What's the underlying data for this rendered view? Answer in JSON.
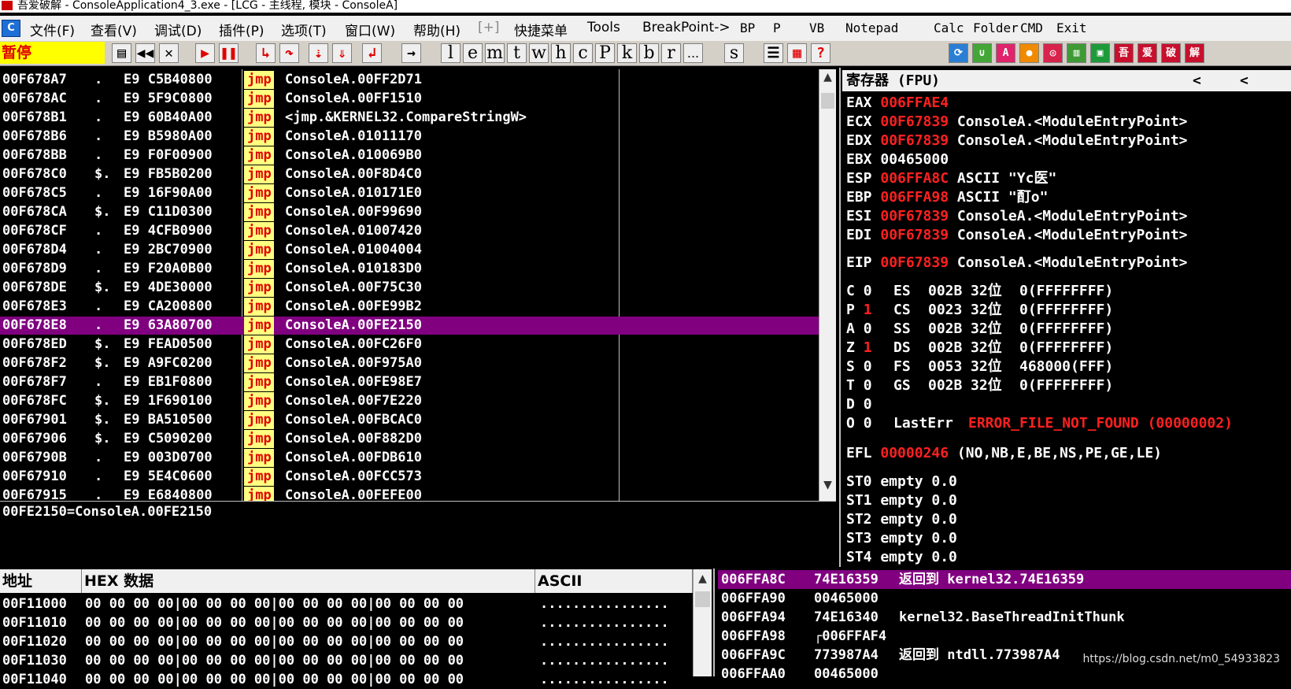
{
  "window": {
    "title": "吾爱破解 - ConsoleApplication4_3.exe - [LCG - 主线程, 模块 - ConsoleA]"
  },
  "menu": {
    "items": [
      "文件(F)",
      "查看(V)",
      "调试(D)",
      "插件(P)",
      "选项(T)",
      "窗口(W)",
      "帮助(H)",
      "[+]",
      "快捷菜单",
      "Tools",
      "BreakPoint->"
    ],
    "buttons": [
      "BP",
      "P",
      "VB",
      "Notepad",
      "Calc",
      "Folder",
      "CMD",
      "Exit"
    ]
  },
  "toolbar": {
    "status": "暂停",
    "letters": [
      "l",
      "e",
      "m",
      "t",
      "w",
      "h",
      "c",
      "P",
      "k",
      "b",
      "r",
      "...",
      "s"
    ],
    "icons": [
      "open-icon",
      "rewind-icon",
      "close-icon",
      "run-icon",
      "pause-icon",
      "step-into-icon",
      "step-over-icon",
      "trace-into-icon",
      "trace-over-icon",
      "execute-till-return-icon",
      "goto-icon",
      "list-icon",
      "grid-icon",
      "help-icon"
    ],
    "plugin_icons": [
      "refresh-icon",
      "plugin-green-icon",
      "plugin-a-icon",
      "plugin-orange-icon",
      "plugin-target-icon",
      "plugin-calc-icon",
      "plugin-screen-icon",
      "plugin-wu-icon",
      "plugin-ai-icon",
      "plugin-po-icon",
      "plugin-jie-icon"
    ]
  },
  "disassembly": {
    "rows": [
      {
        "addr": "00F678A7",
        "mark": ".",
        "hex": "E9 C5B40800",
        "op": "jmp",
        "arg": "ConsoleA.00FF2D71"
      },
      {
        "addr": "00F678AC",
        "mark": ".",
        "hex": "E9 5F9C0800",
        "op": "jmp",
        "arg": "ConsoleA.00FF1510"
      },
      {
        "addr": "00F678B1",
        "mark": ".",
        "hex": "E9 60B40A00",
        "op": "jmp",
        "arg": "<jmp.&KERNEL32.CompareStringW>"
      },
      {
        "addr": "00F678B6",
        "mark": ".",
        "hex": "E9 B5980A00",
        "op": "jmp",
        "arg": "ConsoleA.01011170"
      },
      {
        "addr": "00F678BB",
        "mark": ".",
        "hex": "E9 F0F00900",
        "op": "jmp",
        "arg": "ConsoleA.010069B0"
      },
      {
        "addr": "00F678C0",
        "mark": "$.",
        "hex": "E9 FB5B0200",
        "op": "jmp",
        "arg": "ConsoleA.00F8D4C0"
      },
      {
        "addr": "00F678C5",
        "mark": ".",
        "hex": "E9 16F90A00",
        "op": "jmp",
        "arg": "ConsoleA.010171E0"
      },
      {
        "addr": "00F678CA",
        "mark": "$.",
        "hex": "E9 C11D0300",
        "op": "jmp",
        "arg": "ConsoleA.00F99690"
      },
      {
        "addr": "00F678CF",
        "mark": ".",
        "hex": "E9 4CFB0900",
        "op": "jmp",
        "arg": "ConsoleA.01007420"
      },
      {
        "addr": "00F678D4",
        "mark": ".",
        "hex": "E9 2BC70900",
        "op": "jmp",
        "arg": "ConsoleA.01004004"
      },
      {
        "addr": "00F678D9",
        "mark": ".",
        "hex": "E9 F20A0B00",
        "op": "jmp",
        "arg": "ConsoleA.010183D0"
      },
      {
        "addr": "00F678DE",
        "mark": "$.",
        "hex": "E9 4DE30000",
        "op": "jmp",
        "arg": "ConsoleA.00F75C30"
      },
      {
        "addr": "00F678E3",
        "mark": ".",
        "hex": "E9 CA200800",
        "op": "jmp",
        "arg": "ConsoleA.00FE99B2"
      },
      {
        "addr": "00F678E8",
        "mark": ".",
        "hex": "E9 63A80700",
        "op": "jmp",
        "arg": "ConsoleA.00FE2150"
      },
      {
        "addr": "00F678ED",
        "mark": "$.",
        "hex": "E9 FEAD0500",
        "op": "jmp",
        "arg": "ConsoleA.00FC26F0"
      },
      {
        "addr": "00F678F2",
        "mark": "$.",
        "hex": "E9 A9FC0200",
        "op": "jmp",
        "arg": "ConsoleA.00F975A0"
      },
      {
        "addr": "00F678F7",
        "mark": ".",
        "hex": "E9 EB1F0800",
        "op": "jmp",
        "arg": "ConsoleA.00FE98E7"
      },
      {
        "addr": "00F678FC",
        "mark": "$.",
        "hex": "E9 1F690100",
        "op": "jmp",
        "arg": "ConsoleA.00F7E220"
      },
      {
        "addr": "00F67901",
        "mark": "$.",
        "hex": "E9 BA510500",
        "op": "jmp",
        "arg": "ConsoleA.00FBCAC0"
      },
      {
        "addr": "00F67906",
        "mark": "$.",
        "hex": "E9 C5090200",
        "op": "jmp",
        "arg": "ConsoleA.00F882D0"
      },
      {
        "addr": "00F6790B",
        "mark": ".",
        "hex": "E9 003D0700",
        "op": "jmp",
        "arg": "ConsoleA.00FDB610"
      },
      {
        "addr": "00F67910",
        "mark": ".",
        "hex": "E9 5E4C0600",
        "op": "jmp",
        "arg": "ConsoleA.00FCC573"
      },
      {
        "addr": "00F67915",
        "mark": ".",
        "hex": "E9 E6840800",
        "op": "jmp",
        "arg": "ConsoleA.00FEFE00"
      }
    ],
    "selected_index": 13,
    "info_line": "00FE2150=ConsoleA.00FE2150"
  },
  "registers": {
    "header": "寄存器 (FPU)",
    "nav_left": "<",
    "nav_left2": "<",
    "gp": [
      {
        "name": "EAX",
        "value": "006FFAE4",
        "red": true,
        "comment": ""
      },
      {
        "name": "ECX",
        "value": "00F67839",
        "red": true,
        "comment": "ConsoleA.<ModuleEntryPoint>"
      },
      {
        "name": "EDX",
        "value": "00F67839",
        "red": true,
        "comment": "ConsoleA.<ModuleEntryPoint>"
      },
      {
        "name": "EBX",
        "value": "00465000",
        "red": false,
        "comment": ""
      },
      {
        "name": "ESP",
        "value": "006FFA8C",
        "red": true,
        "comment": "ASCII \"Yc医\""
      },
      {
        "name": "EBP",
        "value": "006FFA98",
        "red": true,
        "comment": "ASCII \"酊o\""
      },
      {
        "name": "ESI",
        "value": "00F67839",
        "red": true,
        "comment": "ConsoleA.<ModuleEntryPoint>"
      },
      {
        "name": "EDI",
        "value": "00F67839",
        "red": true,
        "comment": "ConsoleA.<ModuleEntryPoint>"
      }
    ],
    "eip": {
      "name": "EIP",
      "value": "00F67839",
      "comment": "ConsoleA.<ModuleEntryPoint>"
    },
    "flags": [
      {
        "flag": "C",
        "bit": "0",
        "red": false,
        "seg": "ES",
        "sel": "002B",
        "bits": "32位",
        "base": "0(FFFFFFFF)"
      },
      {
        "flag": "P",
        "bit": "1",
        "red": true,
        "seg": "CS",
        "sel": "0023",
        "bits": "32位",
        "base": "0(FFFFFFFF)"
      },
      {
        "flag": "A",
        "bit": "0",
        "red": false,
        "seg": "SS",
        "sel": "002B",
        "bits": "32位",
        "base": "0(FFFFFFFF)"
      },
      {
        "flag": "Z",
        "bit": "1",
        "red": true,
        "seg": "DS",
        "sel": "002B",
        "bits": "32位",
        "base": "0(FFFFFFFF)"
      },
      {
        "flag": "S",
        "bit": "0",
        "red": false,
        "seg": "FS",
        "sel": "0053",
        "bits": "32位",
        "base": "468000(FFF)"
      },
      {
        "flag": "T",
        "bit": "0",
        "red": false,
        "seg": "GS",
        "sel": "002B",
        "bits": "32位",
        "base": "0(FFFFFFFF)"
      },
      {
        "flag": "D",
        "bit": "0",
        "red": false,
        "seg": "",
        "sel": "",
        "bits": "",
        "base": ""
      },
      {
        "flag": "O",
        "bit": "0",
        "red": false,
        "seg": "",
        "sel": "",
        "bits": "",
        "base": ""
      }
    ],
    "lasterr": {
      "label": "LastErr",
      "value": "ERROR_FILE_NOT_FOUND (00000002)"
    },
    "efl": {
      "label": "EFL",
      "value": "00000246",
      "desc": "(NO,NB,E,BE,NS,PE,GE,LE)"
    },
    "fpu": [
      "ST0 empty 0.0",
      "ST1 empty 0.0",
      "ST2 empty 0.0",
      "ST3 empty 0.0",
      "ST4 empty 0.0"
    ]
  },
  "dump": {
    "header_addr": "地址",
    "header_hex": "HEX 数据",
    "header_ascii": "ASCII",
    "rows": [
      {
        "addr": "00F11000",
        "hex": "00 00 00 00|00 00 00 00|00 00 00 00|00 00 00 00",
        "ascii": "................"
      },
      {
        "addr": "00F11010",
        "hex": "00 00 00 00|00 00 00 00|00 00 00 00|00 00 00 00",
        "ascii": "................"
      },
      {
        "addr": "00F11020",
        "hex": "00 00 00 00|00 00 00 00|00 00 00 00|00 00 00 00",
        "ascii": "................"
      },
      {
        "addr": "00F11030",
        "hex": "00 00 00 00|00 00 00 00|00 00 00 00|00 00 00 00",
        "ascii": "................"
      },
      {
        "addr": "00F11040",
        "hex": "00 00 00 00|00 00 00 00|00 00 00 00|00 00 00 00",
        "ascii": "................"
      }
    ]
  },
  "stack": {
    "rows": [
      {
        "addr": "006FFA8C",
        "value": "74E16359",
        "comment": "返回到 kernel32.74E16359",
        "selected": true
      },
      {
        "addr": "006FFA90",
        "value": "00465000",
        "comment": "",
        "selected": false
      },
      {
        "addr": "006FFA94",
        "value": "74E16340",
        "comment": "kernel32.BaseThreadInitThunk",
        "selected": false
      },
      {
        "addr": "006FFA98",
        "value": "┌006FFAF4",
        "comment": "",
        "selected": false
      },
      {
        "addr": "006FFA9C",
        "value": "773987A4",
        "comment": "返回到 ntdll.773987A4",
        "selected": false
      },
      {
        "addr": "006FFAA0",
        "value": "00465000",
        "comment": "",
        "selected": false
      }
    ]
  },
  "watermark": "https://blog.csdn.net/m0_54933823",
  "colors": {
    "selection": "#800080",
    "changed_register": "#ff2020",
    "status_bg": "#ffff00",
    "jmp_bg": "#ffff80"
  }
}
